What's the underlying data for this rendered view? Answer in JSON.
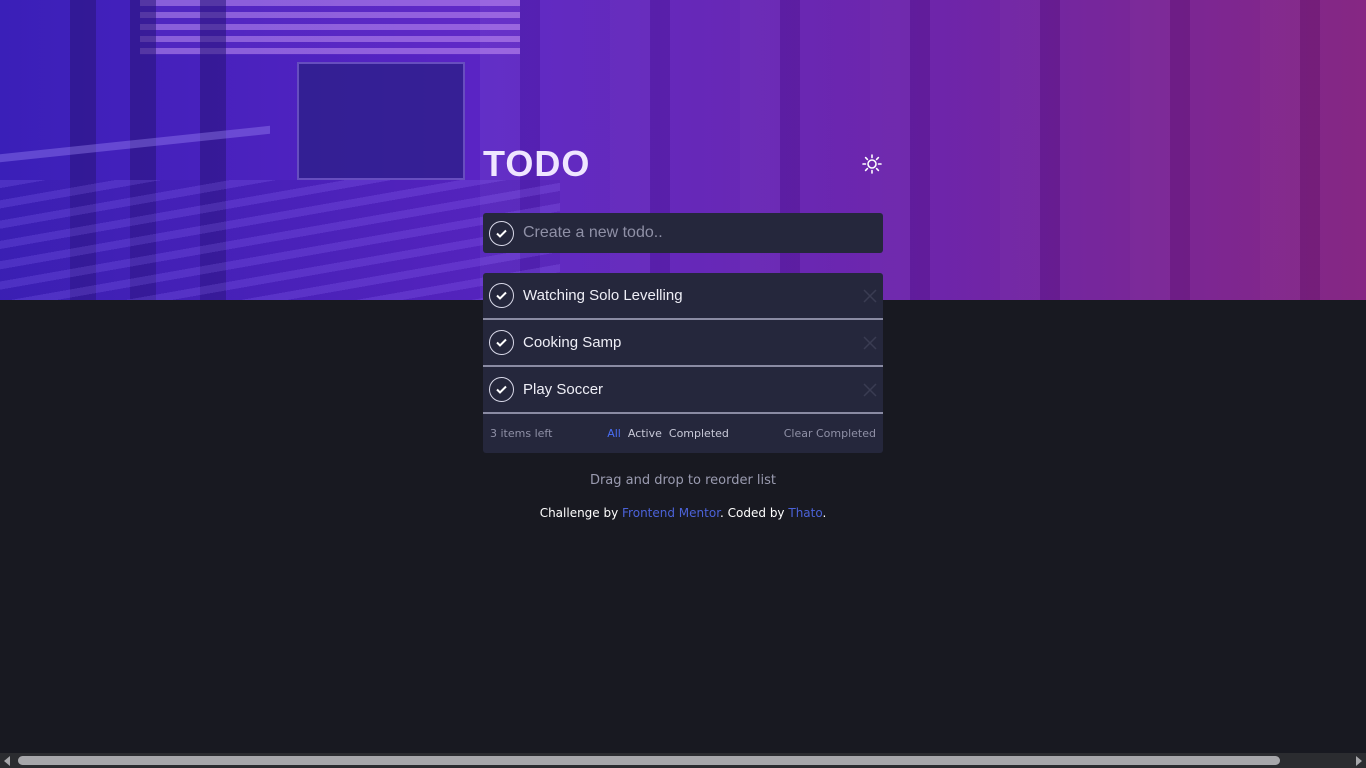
{
  "app": {
    "title": "TODO"
  },
  "new_todo": {
    "placeholder": "Create a new todo.."
  },
  "todos": [
    {
      "text": "Watching Solo Levelling"
    },
    {
      "text": "Cooking Samp"
    },
    {
      "text": "Play Soccer"
    }
  ],
  "footer": {
    "items_left": "3 items left",
    "filters": {
      "all": "All",
      "active": "Active",
      "completed": "Completed"
    },
    "clear_label": "Clear Completed"
  },
  "hint": "Drag and drop to reorder list",
  "attribution": {
    "prefix": "Challenge by ",
    "link1": "Frontend Mentor",
    "middle": ". Coded by ",
    "link2": "Thato",
    "suffix": "."
  },
  "colors": {
    "accent": "#4a6ef5",
    "panel": "#25273c",
    "background": "#181921"
  },
  "icons": {
    "theme": "sun-icon",
    "check": "check-icon",
    "delete": "close-icon"
  }
}
